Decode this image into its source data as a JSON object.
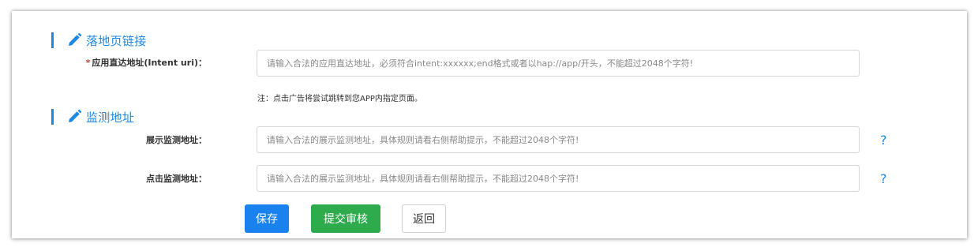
{
  "landing": {
    "section_title": "落地页链接",
    "intent_label": "应用直达地址(Intent uri)：",
    "intent_required_mark": "*",
    "intent_placeholder": "请输入合法的应用直达地址，必须符合intent:xxxxxx;end格式或者以hap://app/开头，不能超过2048个字符!",
    "note": "注：点击广告将尝试跳转到您APP内指定页面。"
  },
  "monitor": {
    "section_title": "监测地址",
    "impression_label": "展示监测地址：",
    "impression_placeholder": "请输入合法的展示监测地址，具体规则请看右侧帮助提示，不能超过2048个字符!",
    "click_label": "点击监测地址：",
    "click_placeholder": "请输入合法的展示监测地址，具体规则请看右侧帮助提示，不能超过2048个字符!",
    "help_symbol": "?"
  },
  "actions": {
    "save_label": "保存",
    "submit_label": "提交审核",
    "back_label": "返回"
  },
  "colors": {
    "accent": "#1e88e5",
    "save_button": "#1a82ee",
    "submit_button": "#2eab4c",
    "required": "#e53935"
  },
  "icons": {
    "section_icon": "pencil-icon",
    "help_icon": "question-mark-icon"
  }
}
